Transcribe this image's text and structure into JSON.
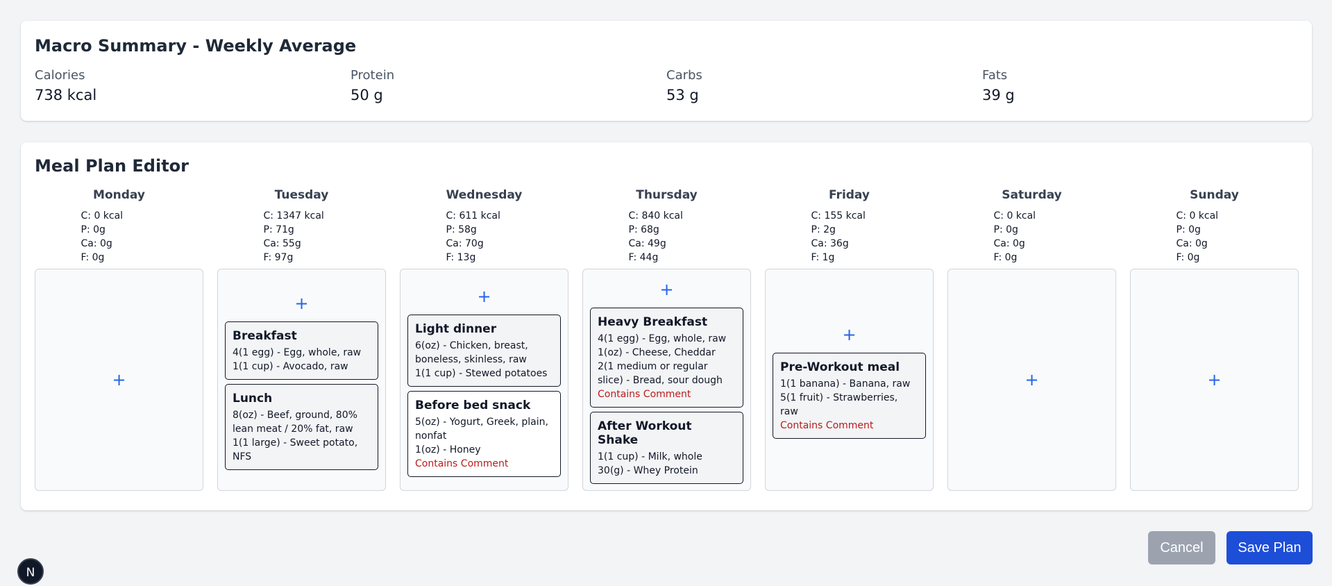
{
  "summary": {
    "title": "Macro Summary - Weekly Average",
    "stats": [
      {
        "label": "Calories",
        "value": "738 kcal"
      },
      {
        "label": "Protein",
        "value": "50 g"
      },
      {
        "label": "Carbs",
        "value": "53 g"
      },
      {
        "label": "Fats",
        "value": "39 g"
      }
    ]
  },
  "editor": {
    "title": "Meal Plan Editor",
    "add_symbol": "+",
    "days": [
      {
        "name": "Monday",
        "totals": [
          "C: 0 kcal",
          "P: 0g",
          "Ca: 0g",
          "F: 0g"
        ],
        "meals": []
      },
      {
        "name": "Tuesday",
        "totals": [
          "C: 1347 kcal",
          "P: 71g",
          "Ca: 55g",
          "F: 97g"
        ],
        "meals": [
          {
            "name": "Breakfast",
            "items": [
              "4(1 egg) - Egg, whole, raw",
              "1(1 cup) - Avocado, raw"
            ],
            "comment": ""
          },
          {
            "name": "Lunch",
            "items": [
              "8(oz) - Beef, ground, 80% lean meat / 20% fat, raw",
              "1(1 large) - Sweet potato, NFS"
            ],
            "comment": ""
          }
        ]
      },
      {
        "name": "Wednesday",
        "totals": [
          "C: 611 kcal",
          "P: 58g",
          "Ca: 70g",
          "F: 13g"
        ],
        "meals": [
          {
            "name": "Light dinner",
            "items": [
              "6(oz) - Chicken, breast, boneless, skinless, raw",
              "1(1 cup) - Stewed potatoes"
            ],
            "comment": ""
          },
          {
            "name": "Before bed snack",
            "items": [
              "5(oz) - Yogurt, Greek, plain, nonfat",
              "1(oz) - Honey"
            ],
            "comment": "Contains Comment",
            "white": true
          }
        ]
      },
      {
        "name": "Thursday",
        "totals": [
          "C: 840 kcal",
          "P: 68g",
          "Ca: 49g",
          "F: 44g"
        ],
        "meals": [
          {
            "name": "Heavy Breakfast",
            "items": [
              "4(1 egg) - Egg, whole, raw",
              "1(oz) - Cheese, Cheddar",
              "2(1 medium or regular slice) - Bread, sour dough"
            ],
            "comment": "Contains Comment"
          },
          {
            "name": "After Workout Shake",
            "items": [
              "1(1 cup) - Milk, whole",
              "30(g) - Whey Protein"
            ],
            "comment": ""
          }
        ]
      },
      {
        "name": "Friday",
        "totals": [
          "C: 155 kcal",
          "P: 2g",
          "Ca: 36g",
          "F: 1g"
        ],
        "meals": [
          {
            "name": "Pre-Workout meal",
            "items": [
              "1(1 banana) - Banana, raw",
              "5(1 fruit) - Strawberries, raw"
            ],
            "comment": "Contains Comment"
          }
        ]
      },
      {
        "name": "Saturday",
        "totals": [
          "C: 0 kcal",
          "P: 0g",
          "Ca: 0g",
          "F: 0g"
        ],
        "meals": []
      },
      {
        "name": "Sunday",
        "totals": [
          "C: 0 kcal",
          "P: 0g",
          "Ca: 0g",
          "F: 0g"
        ],
        "meals": []
      }
    ]
  },
  "actions": {
    "cancel_label": "Cancel",
    "save_label": "Save Plan"
  },
  "avatar": {
    "letter": "N"
  }
}
